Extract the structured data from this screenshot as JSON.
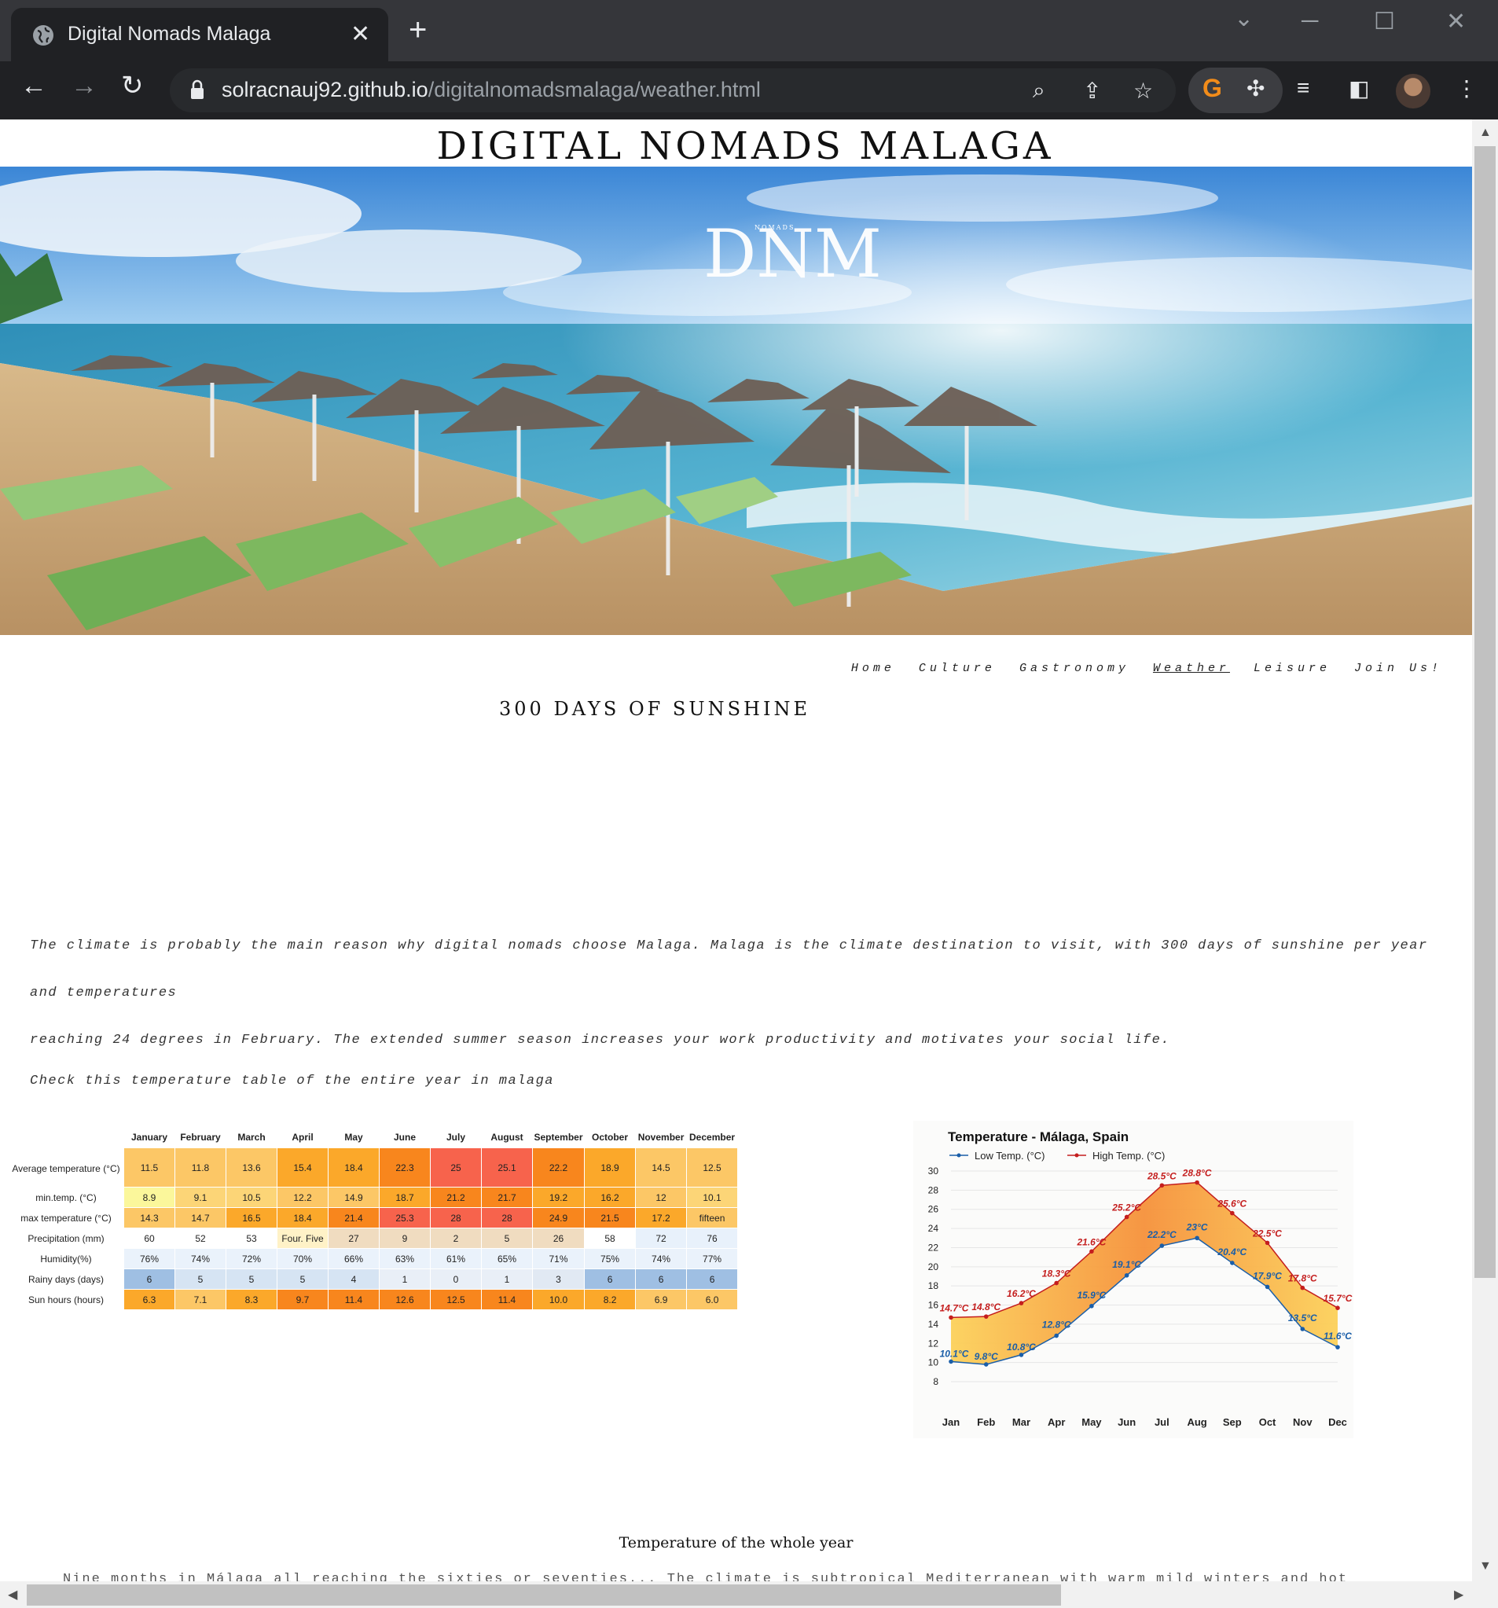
{
  "browser": {
    "tab_title": "Digital Nomads Malaga",
    "url_host": "solracnauj92.github.io",
    "url_path": "/digitalnomadsmalaga/weather.html"
  },
  "site": {
    "title": "DIGITAL NOMADS MALAGA",
    "logo_letters": "DNM",
    "logo_word": "NOMADS",
    "nav": [
      "Home",
      "Culture",
      "Gastronomy",
      "Weather",
      "Leisure",
      "Join Us!"
    ],
    "active_nav": "Weather",
    "heading": "300 DAYS OF SUNSHINE",
    "intro_line1": "The climate is probably the main reason why digital nomads choose Malaga. Malaga is the climate destination to visit, with 300 days of sunshine per year and temperatures",
    "intro_line2": "reaching 24 degrees in February. The extended summer season increases your work productivity and motivates your social life.",
    "check_text": "Check this temperature table of the entire year in malaga",
    "caption": "Temperature of the whole year",
    "truncated_text": "Nine months in Málaga all reaching the sixties or seventies... The climate is subtropical Mediterranean with warm mild winters and hot summers in Málaga"
  },
  "table": {
    "months": [
      "January",
      "February",
      "March",
      "April",
      "May",
      "June",
      "July",
      "August",
      "September",
      "October",
      "November",
      "December"
    ],
    "rows": [
      {
        "label": "Average temperature (°C)",
        "values": [
          "11.5",
          "11.8",
          "13.6",
          "15.4",
          "18.4",
          "22.3",
          "25",
          "25.1",
          "22.2",
          "18.9",
          "14.5",
          "12.5"
        ],
        "colors": [
          "#fcc766",
          "#fcc766",
          "#fcc766",
          "#fba82a",
          "#fba82a",
          "#f8861d",
          "#f7634c",
          "#f7634c",
          "#f8861d",
          "#fba82a",
          "#fcc766",
          "#fcc766"
        ]
      },
      {
        "label": "min.temp. (°C)",
        "values": [
          "8.9",
          "9.1",
          "10.5",
          "12.2",
          "14.9",
          "18.7",
          "21.2",
          "21.7",
          "19.2",
          "16.2",
          "12",
          "10.1"
        ],
        "colors": [
          "#fbf79b",
          "#fcd577",
          "#fcd577",
          "#fcc766",
          "#fcc766",
          "#fba82a",
          "#f8861d",
          "#f8861d",
          "#fba82a",
          "#fba82a",
          "#fcc766",
          "#fcd577"
        ]
      },
      {
        "label": "max temperature (°C)",
        "values": [
          "14.3",
          "14.7",
          "16.5",
          "18.4",
          "21.4",
          "25.3",
          "28",
          "28",
          "24.9",
          "21.5",
          "17.2",
          "fifteen"
        ],
        "colors": [
          "#fcc766",
          "#fcc766",
          "#fba82a",
          "#fba82a",
          "#f8861d",
          "#f7634c",
          "#f7634c",
          "#f7634c",
          "#f8861d",
          "#f8861d",
          "#fba82a",
          "#fcc766"
        ]
      },
      {
        "label": "Precipitation (mm)",
        "values": [
          "60",
          "52",
          "53",
          "Four. Five",
          "27",
          "9",
          "2",
          "5",
          "26",
          "58",
          "72",
          "76"
        ],
        "colors": [
          "#ffffff",
          "#ffffff",
          "#ffffff",
          "#fff2c7",
          "#f0dcc0",
          "#f0dcc0",
          "#f0dcc0",
          "#f0dcc0",
          "#f0dcc0",
          "#ffffff",
          "#e8f1fb",
          "#e8f1fb"
        ]
      },
      {
        "label": "Humidity(%)",
        "values": [
          "76%",
          "74%",
          "72%",
          "70%",
          "66%",
          "63%",
          "61%",
          "65%",
          "71%",
          "75%",
          "74%",
          "77%"
        ],
        "colors": [
          "#eaf2fb",
          "#eaf2fb",
          "#eaf2fb",
          "#eaf2fb",
          "#eaf2fb",
          "#eaf2fb",
          "#eaf2fb",
          "#eaf2fb",
          "#eaf2fb",
          "#eaf2fb",
          "#eaf2fb",
          "#eaf2fb"
        ]
      },
      {
        "label": "Rainy days (days)",
        "values": [
          "6",
          "5",
          "5",
          "5",
          "4",
          "1",
          "0",
          "1",
          "3",
          "6",
          "6",
          "6"
        ],
        "colors": [
          "#9fbfe3",
          "#d6e4f3",
          "#d6e4f3",
          "#d6e4f3",
          "#d6e4f3",
          "#e9eff7",
          "#e9eff7",
          "#e9eff7",
          "#e1e9f3",
          "#9fbfe3",
          "#9fbfe3",
          "#9fbfe3"
        ]
      },
      {
        "label": "Sun hours (hours)",
        "values": [
          "6.3",
          "7.1",
          "8.3",
          "9.7",
          "11.4",
          "12.6",
          "12.5",
          "11.4",
          "10.0",
          "8.2",
          "6.9",
          "6.0"
        ],
        "colors": [
          "#fba82a",
          "#fcc766",
          "#fba82a",
          "#f8861d",
          "#f8861d",
          "#f8861d",
          "#f8861d",
          "#f8861d",
          "#fba82a",
          "#fba82a",
          "#fcc766",
          "#fcc766"
        ]
      }
    ]
  },
  "chart_data": {
    "type": "line",
    "title": "Temperature - Málaga, Spain",
    "categories": [
      "Jan",
      "Feb",
      "Mar",
      "Apr",
      "May",
      "Jun",
      "Jul",
      "Aug",
      "Sep",
      "Oct",
      "Nov",
      "Dec"
    ],
    "series": [
      {
        "name": "Low Temp. (°C)",
        "values": [
          10.1,
          9.8,
          10.8,
          12.8,
          15.9,
          19.1,
          22.2,
          23,
          20.4,
          17.9,
          13.5,
          11.6
        ],
        "labels": [
          "10.1°C",
          "9.8°C",
          "10.8°C",
          "12.8°C",
          "15.9°C",
          "19.1°C",
          "22.2°C",
          "23°C",
          "20.4°C",
          "17.9°C",
          "13.5°C",
          "11.6°C"
        ],
        "color": "#1a5ea8"
      },
      {
        "name": "High Temp. (°C)",
        "values": [
          14.7,
          14.8,
          16.2,
          18.3,
          21.6,
          25.2,
          28.5,
          28.8,
          25.6,
          22.5,
          17.8,
          15.7
        ],
        "labels": [
          "14.7°C",
          "14.8°C",
          "16.2°C",
          "18.3°C",
          "21.6°C",
          "25.2°C",
          "28.5°C",
          "28.8°C",
          "25.6°C",
          "22.5°C",
          "17.8°C",
          "15.7°C"
        ],
        "color": "#c41e1e"
      }
    ],
    "yticks": [
      "30",
      "28",
      "26",
      "24",
      "22",
      "20",
      "18",
      "16",
      "14",
      "12",
      "10",
      "8"
    ],
    "ylim": [
      8,
      30
    ],
    "grid": true,
    "legend": "top-left"
  }
}
